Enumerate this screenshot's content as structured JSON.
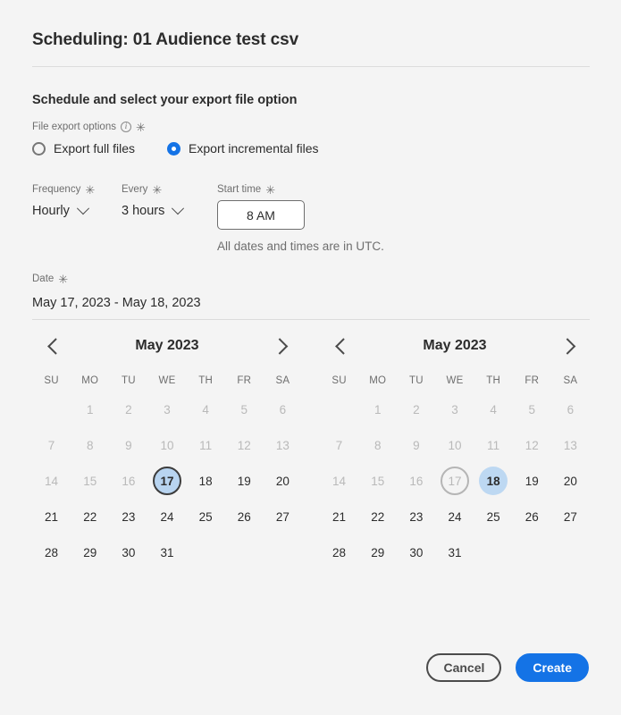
{
  "dialog": {
    "title": "Scheduling: 01 Audience test csv",
    "section_heading": "Schedule and select your export file option"
  },
  "file_export": {
    "label": "File export options",
    "info_icon": "info-icon",
    "required_marker": "✳",
    "options": [
      {
        "label": "Export full files",
        "selected": false
      },
      {
        "label": "Export incremental files",
        "selected": true
      }
    ]
  },
  "frequency": {
    "label": "Frequency",
    "value": "Hourly"
  },
  "every": {
    "label": "Every",
    "value": "3 hours"
  },
  "start_time": {
    "label": "Start time",
    "value": "8 AM",
    "note": "All dates and times are in UTC."
  },
  "date": {
    "label": "Date",
    "range_value": "May 17, 2023 - May 18, 2023"
  },
  "calendars": [
    {
      "name": "start-date-calendar",
      "title": "May 2023",
      "prev_label": "‹",
      "next_label": "›",
      "weekdays": [
        "SU",
        "MO",
        "TU",
        "WE",
        "TH",
        "FR",
        "SA"
      ],
      "weeks": [
        [
          {
            "text": "",
            "state": "empty"
          },
          {
            "text": "1",
            "state": "disabled"
          },
          {
            "text": "2",
            "state": "disabled"
          },
          {
            "text": "3",
            "state": "disabled"
          },
          {
            "text": "4",
            "state": "disabled"
          },
          {
            "text": "5",
            "state": "disabled"
          },
          {
            "text": "6",
            "state": "disabled"
          }
        ],
        [
          {
            "text": "7",
            "state": "disabled"
          },
          {
            "text": "8",
            "state": "disabled"
          },
          {
            "text": "9",
            "state": "disabled"
          },
          {
            "text": "10",
            "state": "disabled"
          },
          {
            "text": "11",
            "state": "disabled"
          },
          {
            "text": "12",
            "state": "disabled"
          },
          {
            "text": "13",
            "state": "disabled"
          }
        ],
        [
          {
            "text": "14",
            "state": "disabled"
          },
          {
            "text": "15",
            "state": "disabled"
          },
          {
            "text": "16",
            "state": "disabled"
          },
          {
            "text": "17",
            "state": "selected-ring"
          },
          {
            "text": "18",
            "state": "normal"
          },
          {
            "text": "19",
            "state": "normal"
          },
          {
            "text": "20",
            "state": "normal"
          }
        ],
        [
          {
            "text": "21",
            "state": "normal"
          },
          {
            "text": "22",
            "state": "normal"
          },
          {
            "text": "23",
            "state": "normal"
          },
          {
            "text": "24",
            "state": "normal"
          },
          {
            "text": "25",
            "state": "normal"
          },
          {
            "text": "26",
            "state": "normal"
          },
          {
            "text": "27",
            "state": "normal"
          }
        ],
        [
          {
            "text": "28",
            "state": "normal"
          },
          {
            "text": "29",
            "state": "normal"
          },
          {
            "text": "30",
            "state": "normal"
          },
          {
            "text": "31",
            "state": "normal"
          },
          {
            "text": "",
            "state": "empty"
          },
          {
            "text": "",
            "state": "empty"
          },
          {
            "text": "",
            "state": "empty"
          }
        ]
      ]
    },
    {
      "name": "end-date-calendar",
      "title": "May 2023",
      "prev_label": "‹",
      "next_label": "›",
      "weekdays": [
        "SU",
        "MO",
        "TU",
        "WE",
        "TH",
        "FR",
        "SA"
      ],
      "weeks": [
        [
          {
            "text": "",
            "state": "empty"
          },
          {
            "text": "1",
            "state": "disabled"
          },
          {
            "text": "2",
            "state": "disabled"
          },
          {
            "text": "3",
            "state": "disabled"
          },
          {
            "text": "4",
            "state": "disabled"
          },
          {
            "text": "5",
            "state": "disabled"
          },
          {
            "text": "6",
            "state": "disabled"
          }
        ],
        [
          {
            "text": "7",
            "state": "disabled"
          },
          {
            "text": "8",
            "state": "disabled"
          },
          {
            "text": "9",
            "state": "disabled"
          },
          {
            "text": "10",
            "state": "disabled"
          },
          {
            "text": "11",
            "state": "disabled"
          },
          {
            "text": "12",
            "state": "disabled"
          },
          {
            "text": "13",
            "state": "disabled"
          }
        ],
        [
          {
            "text": "14",
            "state": "disabled"
          },
          {
            "text": "15",
            "state": "disabled"
          },
          {
            "text": "16",
            "state": "disabled"
          },
          {
            "text": "17",
            "state": "disabled-ring"
          },
          {
            "text": "18",
            "state": "selected-fill"
          },
          {
            "text": "19",
            "state": "normal"
          },
          {
            "text": "20",
            "state": "normal"
          }
        ],
        [
          {
            "text": "21",
            "state": "normal"
          },
          {
            "text": "22",
            "state": "normal"
          },
          {
            "text": "23",
            "state": "normal"
          },
          {
            "text": "24",
            "state": "normal"
          },
          {
            "text": "25",
            "state": "normal"
          },
          {
            "text": "26",
            "state": "normal"
          },
          {
            "text": "27",
            "state": "normal"
          }
        ],
        [
          {
            "text": "28",
            "state": "normal"
          },
          {
            "text": "29",
            "state": "normal"
          },
          {
            "text": "30",
            "state": "normal"
          },
          {
            "text": "31",
            "state": "normal"
          },
          {
            "text": "",
            "state": "empty"
          },
          {
            "text": "",
            "state": "empty"
          },
          {
            "text": "",
            "state": "empty"
          }
        ]
      ]
    }
  ],
  "footer": {
    "cancel_label": "Cancel",
    "create_label": "Create"
  },
  "colors": {
    "page_background": "#f4f4f4",
    "accent_blue": "#1473e6",
    "selected_day_fill": "#bdd8f2",
    "range_start_fill": "#b8d4f0",
    "text_primary": "#2c2c2c",
    "text_secondary": "#6e6e6e",
    "text_disabled": "#b9b9b9",
    "divider": "#dcdcdc"
  }
}
